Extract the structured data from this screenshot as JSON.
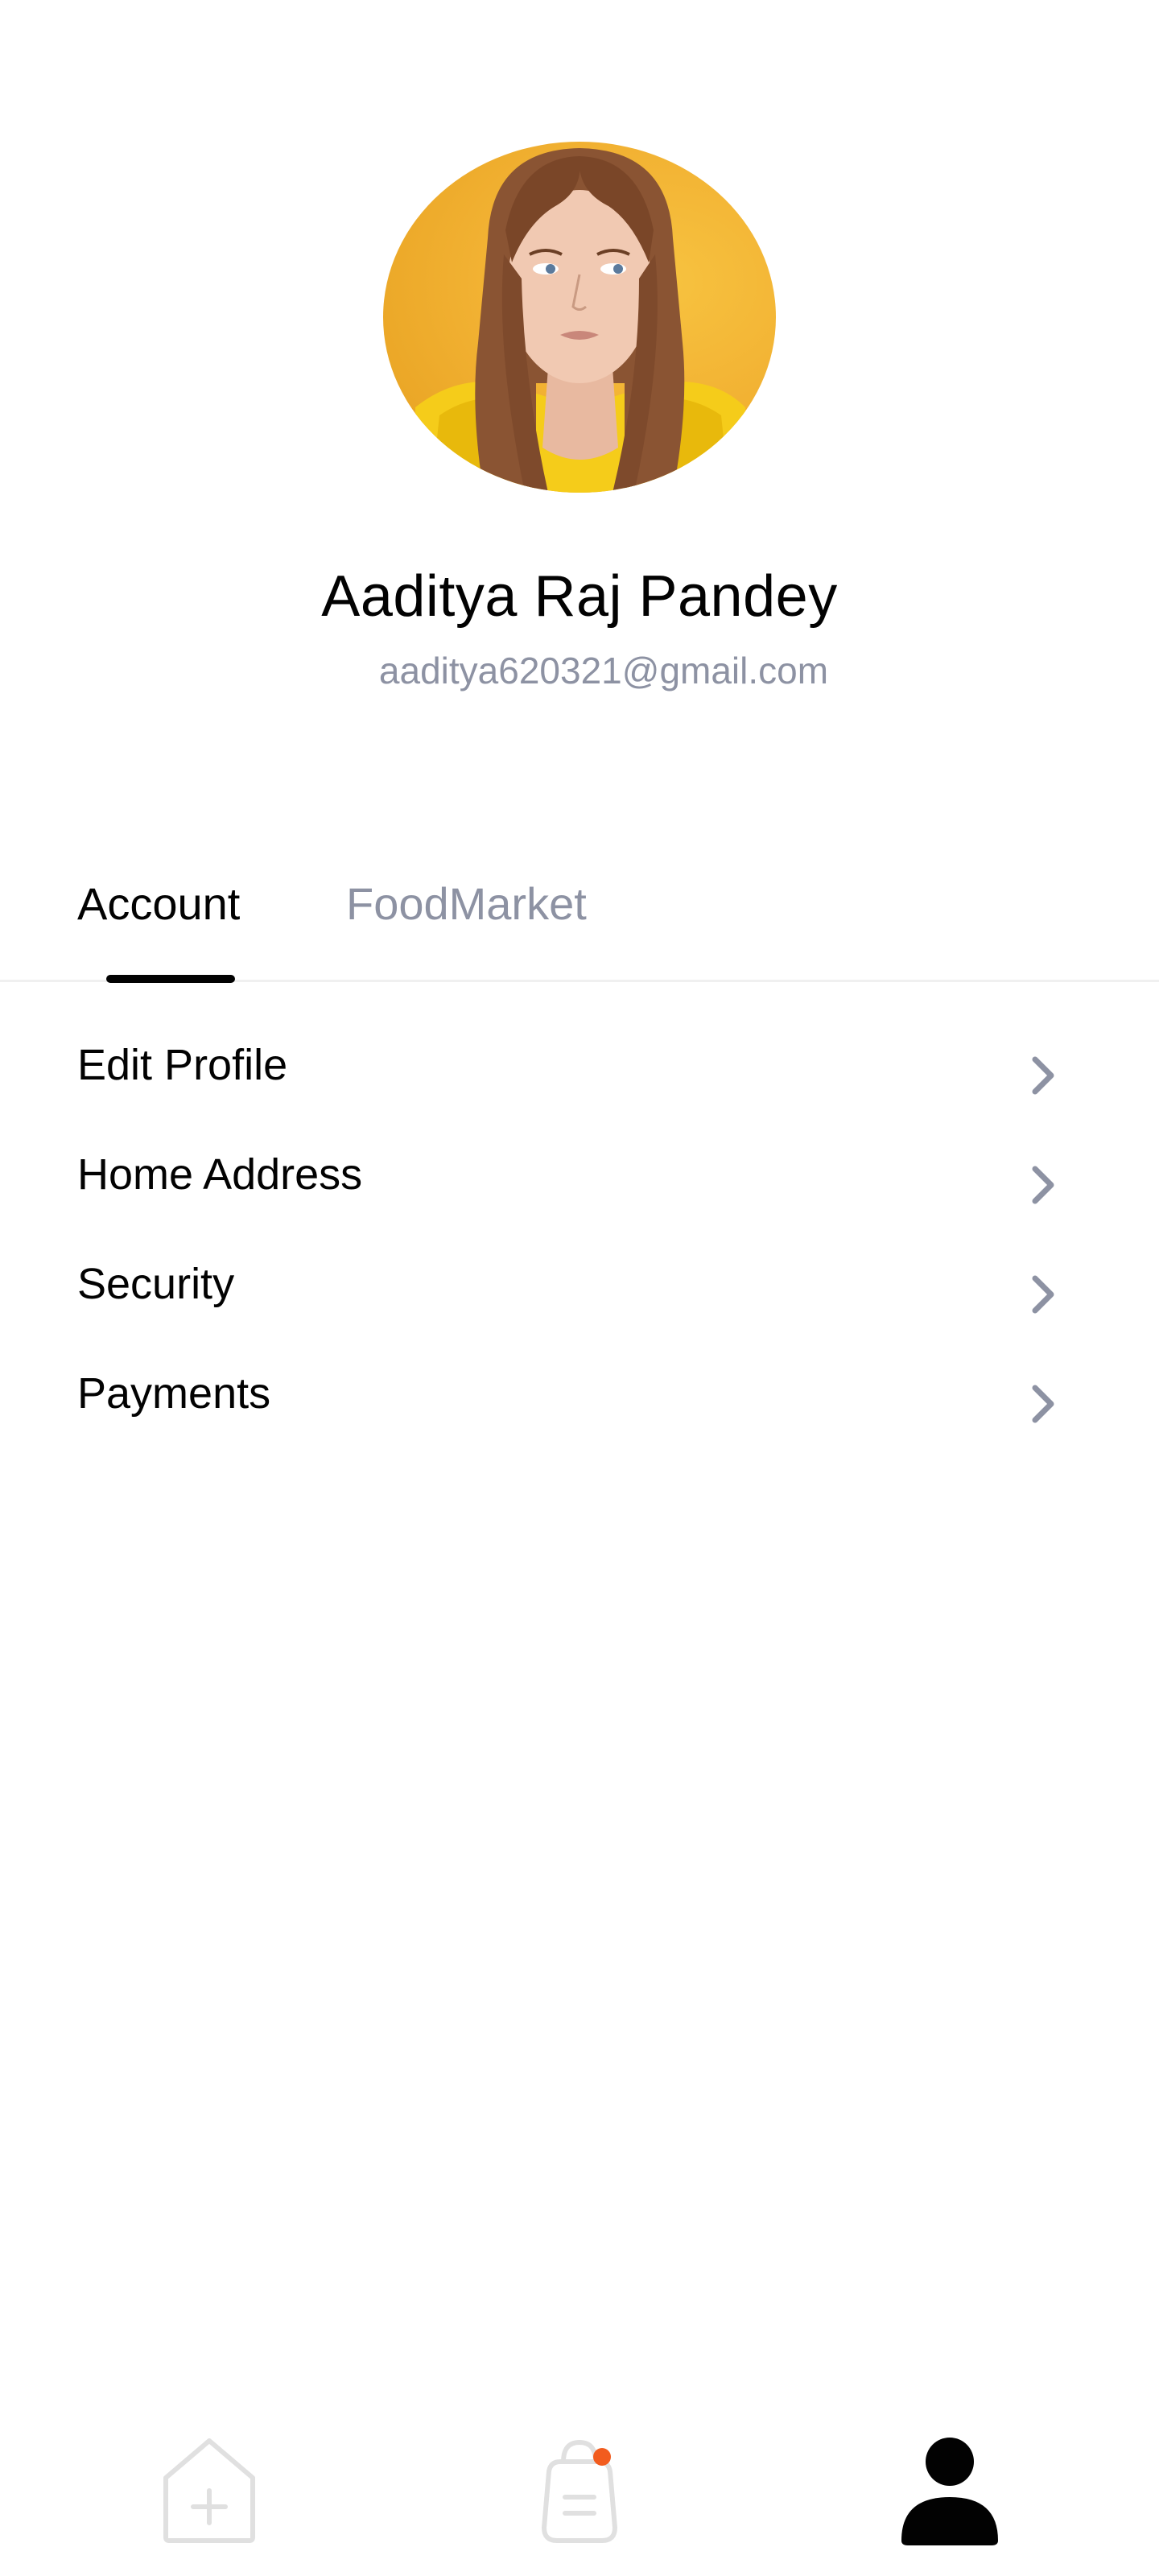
{
  "profile": {
    "name": "Aaditya Raj Pandey",
    "email": "aaditya620321@gmail.com"
  },
  "tabs": [
    {
      "label": "Account",
      "active": true
    },
    {
      "label": "FoodMarket",
      "active": false
    }
  ],
  "menu": {
    "items": [
      {
        "label": "Edit Profile",
        "icon": "chevron-right-icon"
      },
      {
        "label": "Home Address",
        "icon": "chevron-right-icon"
      },
      {
        "label": "Security",
        "icon": "chevron-right-icon"
      },
      {
        "label": "Payments",
        "icon": "chevron-right-icon"
      }
    ]
  },
  "bottom_nav": {
    "items": [
      {
        "icon": "home-icon",
        "active": false
      },
      {
        "icon": "order-bag-icon",
        "active": false,
        "badge": true
      },
      {
        "icon": "profile-icon",
        "active": true
      }
    ]
  },
  "colors": {
    "text_primary": "#020202",
    "text_secondary": "#8d92a3",
    "divider": "#f0f0f0",
    "badge": "#f25c1e",
    "avatar_background": "#f2b233"
  }
}
